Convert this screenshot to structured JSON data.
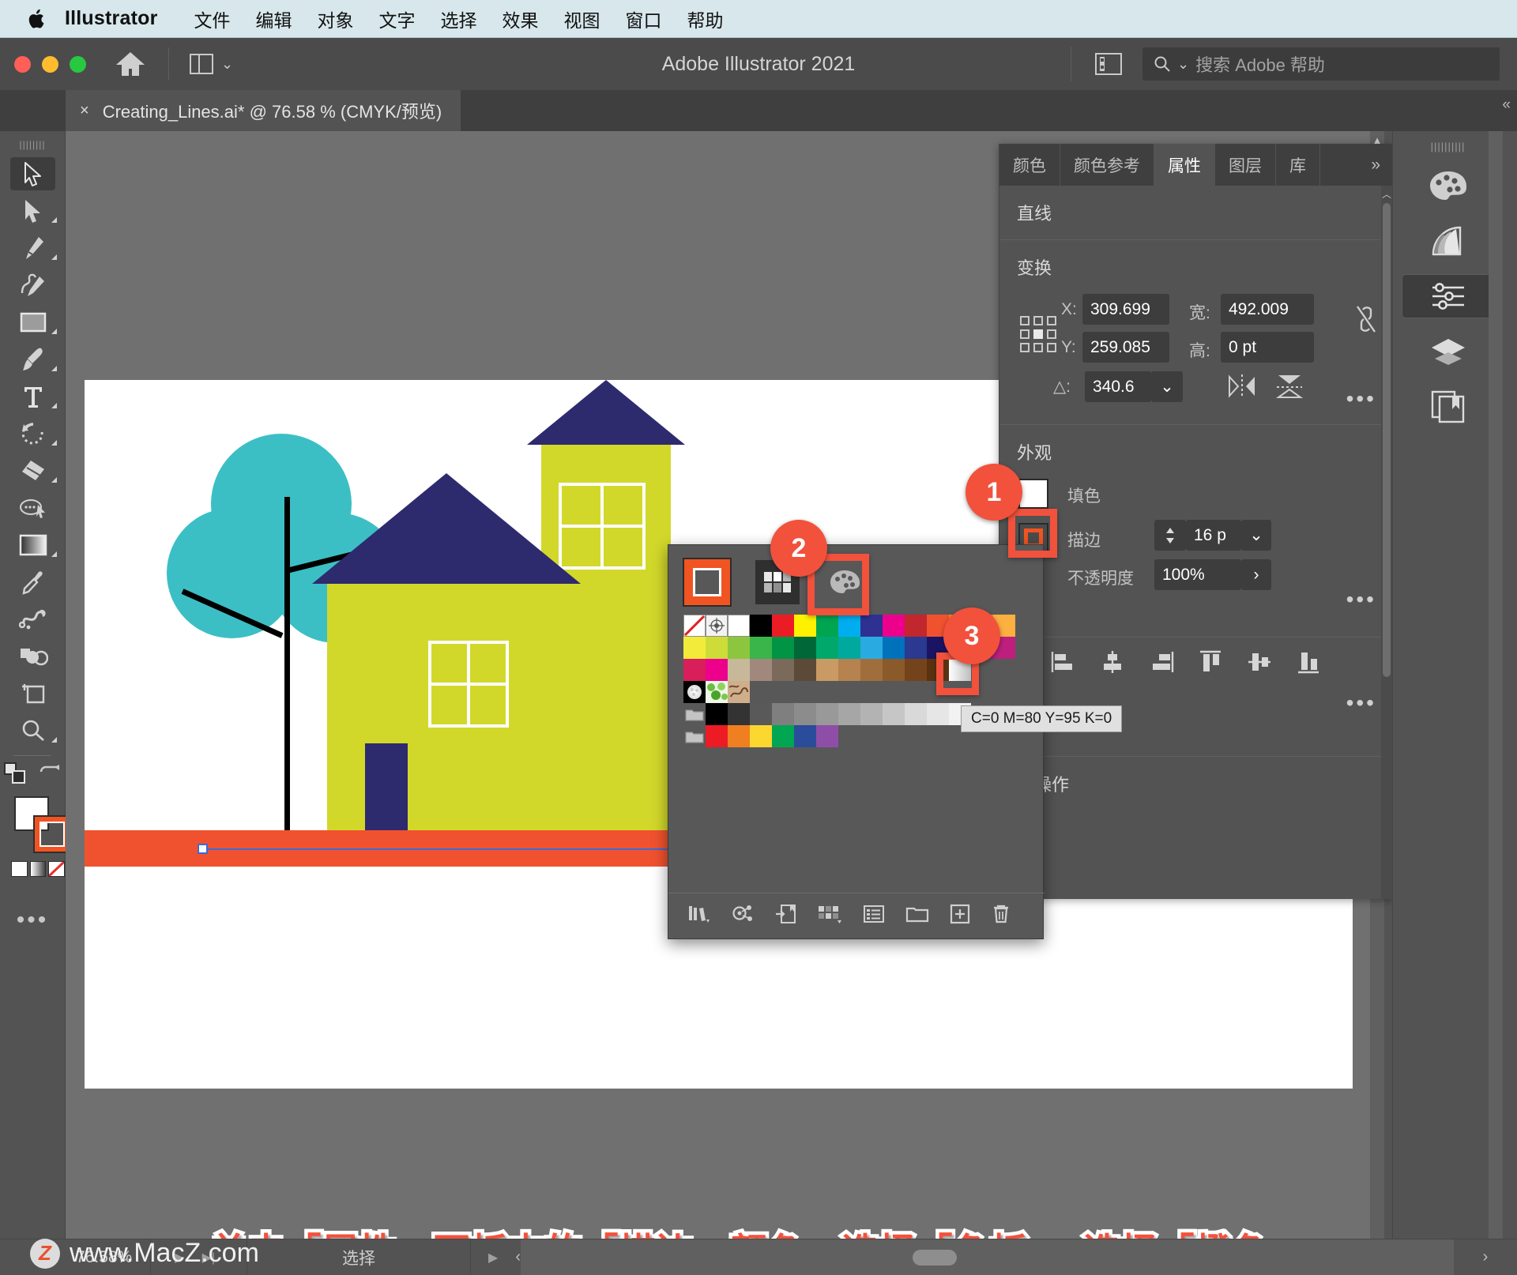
{
  "menubar": {
    "app_name": "Illustrator",
    "items": [
      "文件",
      "编辑",
      "对象",
      "文字",
      "选择",
      "效果",
      "视图",
      "窗口",
      "帮助"
    ]
  },
  "titlebar": {
    "title": "Adobe Illustrator 2021",
    "search_placeholder": "搜索 Adobe 帮助",
    "home_icon": "home-icon",
    "arrange_icon": "arrange-documents-icon",
    "doc_layout_icon": "document-layout-icon",
    "search_icon": "search-icon"
  },
  "tabbar": {
    "close_label": "×",
    "doc_title": "Creating_Lines.ai* @ 76.58 % (CMYK/预览)",
    "collapse_label": "«"
  },
  "toolbar": {
    "tools": [
      {
        "name": "selection-tool",
        "selected": true,
        "has_flyout": false
      },
      {
        "name": "direct-selection-tool",
        "selected": false,
        "has_flyout": true
      },
      {
        "name": "pen-tool",
        "selected": false,
        "has_flyout": true
      },
      {
        "name": "curvature-tool",
        "selected": false,
        "has_flyout": false
      },
      {
        "name": "rectangle-tool",
        "selected": false,
        "has_flyout": true
      },
      {
        "name": "paintbrush-tool",
        "selected": false,
        "has_flyout": true
      },
      {
        "name": "type-tool",
        "selected": false,
        "has_flyout": true
      },
      {
        "name": "rotate-tool",
        "selected": false,
        "has_flyout": true
      },
      {
        "name": "eraser-tool",
        "selected": false,
        "has_flyout": true
      },
      {
        "name": "lasso-tool",
        "selected": false,
        "has_flyout": false
      },
      {
        "name": "gradient-tool",
        "selected": false,
        "has_flyout": true
      },
      {
        "name": "eyedropper-tool",
        "selected": false,
        "has_flyout": false
      },
      {
        "name": "blend-tool",
        "selected": false,
        "has_flyout": false
      },
      {
        "name": "shape-builder-tool",
        "selected": false,
        "has_flyout": false
      },
      {
        "name": "artboard-tool",
        "selected": false,
        "has_flyout": false
      },
      {
        "name": "zoom-tool",
        "selected": false,
        "has_flyout": true
      }
    ],
    "fill_color": "#ffffff",
    "stroke_color": "#f05423",
    "more_tools_label": "•••"
  },
  "panel": {
    "tabs": [
      {
        "label": "颜色",
        "active": false
      },
      {
        "label": "颜色参考",
        "active": false
      },
      {
        "label": "属性",
        "active": true
      },
      {
        "label": "图层",
        "active": false
      },
      {
        "label": "库",
        "active": false
      }
    ],
    "more_tabs": "»",
    "object_type": "直线",
    "transform": {
      "title": "变换",
      "x_label": "X:",
      "x_value": "309.699",
      "y_label": "Y:",
      "y_value": "259.085",
      "w_label": "宽:",
      "w_value": "492.009",
      "h_label": "高:",
      "h_value": "0 pt",
      "angle_label": "△:",
      "angle_value": "340.6",
      "link_icon": "link-broken-icon",
      "flip_h_icon": "flip-horizontal-icon",
      "flip_v_icon": "flip-vertical-icon",
      "more_icon": "more-options-icon"
    },
    "appearance": {
      "title": "外观",
      "fill_label": "填色",
      "fill_color": "#ffffff",
      "stroke_label": "描边",
      "stroke_color": "#f05423",
      "stroke_weight": "16 p",
      "opacity_label": "不透明度",
      "opacity_value": "100%",
      "more_icon": "more-options-icon"
    },
    "align": {
      "buttons": [
        "align-left-icon",
        "align-center-horizontal-icon",
        "align-right-icon",
        "align-top-icon",
        "align-center-vertical-icon",
        "align-bottom-icon"
      ],
      "more_icon": "more-options-icon"
    },
    "quick_actions_title": "速操作"
  },
  "swatches_popup": {
    "stroke_preview_color": "#f05423",
    "mode_swatches_icon": "swatches-grid-icon",
    "mode_colormixer_icon": "color-palette-icon",
    "tooltip": "C=0 M=80 Y=95 K=0",
    "selected_swatch_color": "#f5821f",
    "rows": [
      {
        "type": "specials",
        "cells": [
          "none",
          "registration",
          "#ffffff",
          "#000000",
          "#ec1c24",
          "#fff200",
          "#00a551",
          "#00aeef",
          "#2e3192",
          "#ec008c",
          "#c1272d",
          "#f0522f",
          "#f5821f",
          "#f7941e",
          "#fbb040"
        ]
      },
      {
        "type": "colors",
        "cells": [
          "#f2eb3a",
          "#cddc39",
          "#8cc63f",
          "#39b54a",
          "#009444",
          "#006838",
          "#00a86b",
          "#00a99d",
          "#29abe2",
          "#0072bc",
          "#2b3990",
          "#1b1464",
          "#662d91",
          "#92278f",
          "#be1e7d"
        ]
      },
      {
        "type": "colors",
        "cells": [
          "#d81e5b",
          "#ec008c",
          "#c8b89a",
          "#a0897c",
          "#7b6a5a",
          "#5c4a38",
          "#c99a63",
          "#b58250",
          "#a06e3c",
          "#8a5a2b",
          "#74431c",
          "#5b3210",
          "#ffffff"
        ]
      },
      {
        "type": "patterns",
        "cells": [
          "pattern-dots",
          "pattern-leaves",
          "pattern-ornament"
        ]
      },
      {
        "type": "grays",
        "folder": true,
        "cells": [
          "#000000",
          "#333333",
          "#595959",
          "#7f7f7f",
          "#8c8c8c",
          "#999999",
          "#a6a6a6",
          "#b3b3b3",
          "#c6c6c6",
          "#d9d9d9",
          "#e6e6e6",
          "#f2f2f2"
        ]
      },
      {
        "type": "brights",
        "folder": true,
        "cells": [
          "#ed1c24",
          "#f07f21",
          "#fcd730",
          "#00a651",
          "#2b4c9b",
          "#8e4ea8"
        ]
      }
    ],
    "footer_icons": [
      "swatch-libraries-icon",
      "color-group-icon",
      "add-to-library-icon",
      "show-swatch-kinds-icon",
      "swatch-options-icon",
      "new-color-group-icon",
      "new-swatch-icon",
      "delete-swatch-icon"
    ]
  },
  "callouts": [
    {
      "number": "1"
    },
    {
      "number": "2"
    },
    {
      "number": "3"
    }
  ],
  "right_dock": {
    "buttons": [
      {
        "name": "color-panel-icon",
        "active": false
      },
      {
        "name": "color-guide-panel-icon",
        "active": false
      },
      {
        "name": "properties-panel-icon",
        "active": true
      },
      {
        "name": "layers-panel-icon",
        "active": false
      },
      {
        "name": "libraries-panel-icon",
        "active": false
      }
    ]
  },
  "artwork": {
    "roof_color": "#2e2a6e",
    "wall_color": "#d2d82a",
    "tree_color": "#3cbfc4",
    "trunk_color": "#000000",
    "ground_color": "#f0522f",
    "window_frame_color": "#ffffff",
    "door_color": "#2e2a6e"
  },
  "statusbar": {
    "zoom": "76.58%",
    "zoom_chevron": "⌄",
    "prev_icon": "play-next-icon",
    "last_icon": "skip-to-end-icon",
    "tool_name": "选择",
    "artboard_nav_icon": "artboard-nav-icon",
    "left_chevron": "‹",
    "right_chevron": "›"
  },
  "caption": {
    "text": "单击「属性」面板中的「描边」颜色，选择「色板」，选择「橙色」"
  },
  "watermark": {
    "badge": "Z",
    "text": "www.MacZ.com"
  }
}
